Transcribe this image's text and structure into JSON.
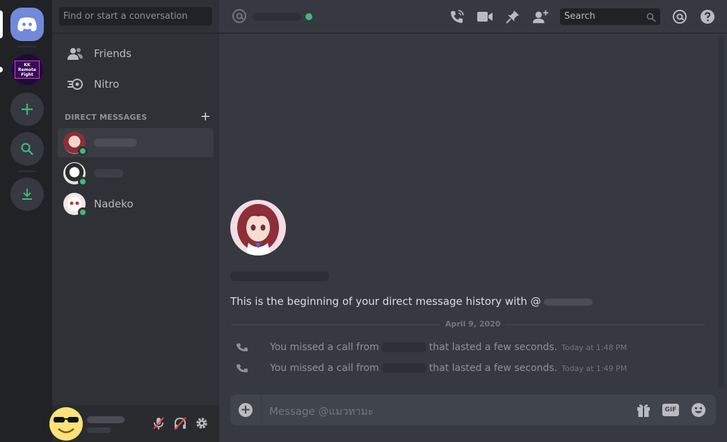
{
  "finder": {
    "placeholder": "Find or start a conversation"
  },
  "nav": {
    "friends_label": "Friends",
    "nitro_label": "Nitro"
  },
  "direct_messages": {
    "header": "DIRECT MESSAGES",
    "add_symbol": "+",
    "items": [
      {
        "name": "",
        "status": "online",
        "active": true
      },
      {
        "name": "",
        "status": "online",
        "active": false
      },
      {
        "name": "Nadeko",
        "status": "online",
        "active": false
      }
    ]
  },
  "servers": {
    "kk_badge_text": "KK Remote Fight"
  },
  "user_panel": {
    "name": "",
    "tag": ""
  },
  "header": {
    "search_placeholder": "Search"
  },
  "conversation": {
    "intro": "This is the beginning of your direct message history with @",
    "date_divider": "April 9, 2020",
    "calls": [
      {
        "prefix": "You missed a call from",
        "suffix": "that lasted a few seconds.",
        "time": "Today at 1:48 PM"
      },
      {
        "prefix": "You missed a call from",
        "suffix": "that lasted a few seconds.",
        "time": "Today at 1:49 PM"
      }
    ]
  },
  "composer": {
    "placeholder": "Message @แมวทามะ",
    "add_symbol": "+",
    "gif_label": "GIF"
  },
  "colors": {
    "online": "#43b581",
    "brand": "#7289da",
    "background": "#36393f",
    "sidebar": "#2f3136",
    "rail": "#202225"
  }
}
